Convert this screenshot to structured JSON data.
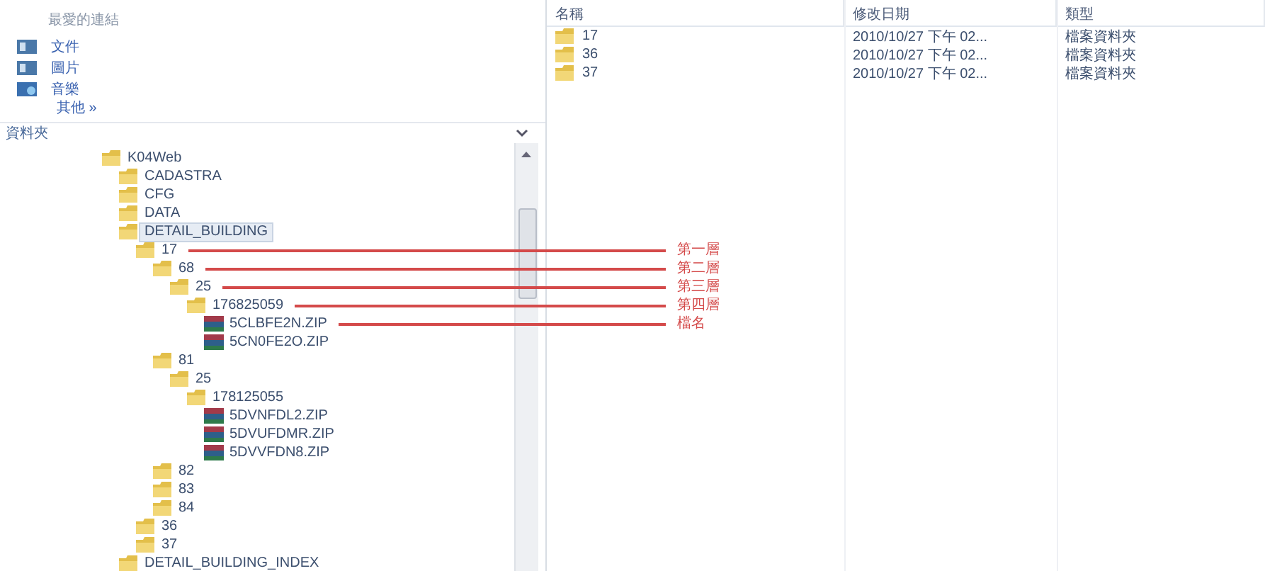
{
  "favorites": {
    "title": "最愛的連結",
    "items": [
      {
        "label": "文件",
        "kind": "doc"
      },
      {
        "label": "圖片",
        "kind": "doc"
      },
      {
        "label": "音樂",
        "kind": "music"
      }
    ],
    "more": "其他 »"
  },
  "folders_header": "資料夾",
  "tree": [
    {
      "label": "K04Web",
      "kind": "folder",
      "children": [
        {
          "label": "CADASTRA",
          "kind": "folder"
        },
        {
          "label": "CFG",
          "kind": "folder"
        },
        {
          "label": "DATA",
          "kind": "folder"
        },
        {
          "label": "DETAIL_BUILDING",
          "kind": "folder",
          "selected": true,
          "children": [
            {
              "label": "17",
              "kind": "folder",
              "annotation": "第一層",
              "children": [
                {
                  "label": "68",
                  "kind": "folder",
                  "annotation": "第二層",
                  "children": [
                    {
                      "label": "25",
                      "kind": "folder",
                      "annotation": "第三層",
                      "children": [
                        {
                          "label": "176825059",
                          "kind": "folder",
                          "annotation": "第四層",
                          "children": [
                            {
                              "label": "5CLBFE2N.ZIP",
                              "kind": "zip",
                              "annotation": "檔名"
                            },
                            {
                              "label": "5CN0FE2O.ZIP",
                              "kind": "zip"
                            }
                          ]
                        }
                      ]
                    }
                  ]
                },
                {
                  "label": "81",
                  "kind": "folder",
                  "children": [
                    {
                      "label": "25",
                      "kind": "folder",
                      "children": [
                        {
                          "label": "178125055",
                          "kind": "folder",
                          "children": [
                            {
                              "label": "5DVNFDL2.ZIP",
                              "kind": "zip"
                            },
                            {
                              "label": "5DVUFDMR.ZIP",
                              "kind": "zip"
                            },
                            {
                              "label": "5DVVFDN8.ZIP",
                              "kind": "zip"
                            }
                          ]
                        }
                      ]
                    }
                  ]
                },
                {
                  "label": "82",
                  "kind": "folder"
                },
                {
                  "label": "83",
                  "kind": "folder"
                },
                {
                  "label": "84",
                  "kind": "folder"
                }
              ]
            },
            {
              "label": "36",
              "kind": "folder"
            },
            {
              "label": "37",
              "kind": "folder"
            }
          ]
        },
        {
          "label": "DETAIL_BUILDING_INDEX",
          "kind": "folder"
        }
      ]
    }
  ],
  "table": {
    "columns": [
      "名稱",
      "修改日期",
      "類型"
    ],
    "rows": [
      {
        "name": "17",
        "modified": "2010/10/27 下午 02...",
        "type": "檔案資料夾"
      },
      {
        "name": "36",
        "modified": "2010/10/27 下午 02...",
        "type": "檔案資料夾"
      },
      {
        "name": "37",
        "modified": "2010/10/27 下午 02...",
        "type": "檔案資料夾"
      }
    ]
  }
}
